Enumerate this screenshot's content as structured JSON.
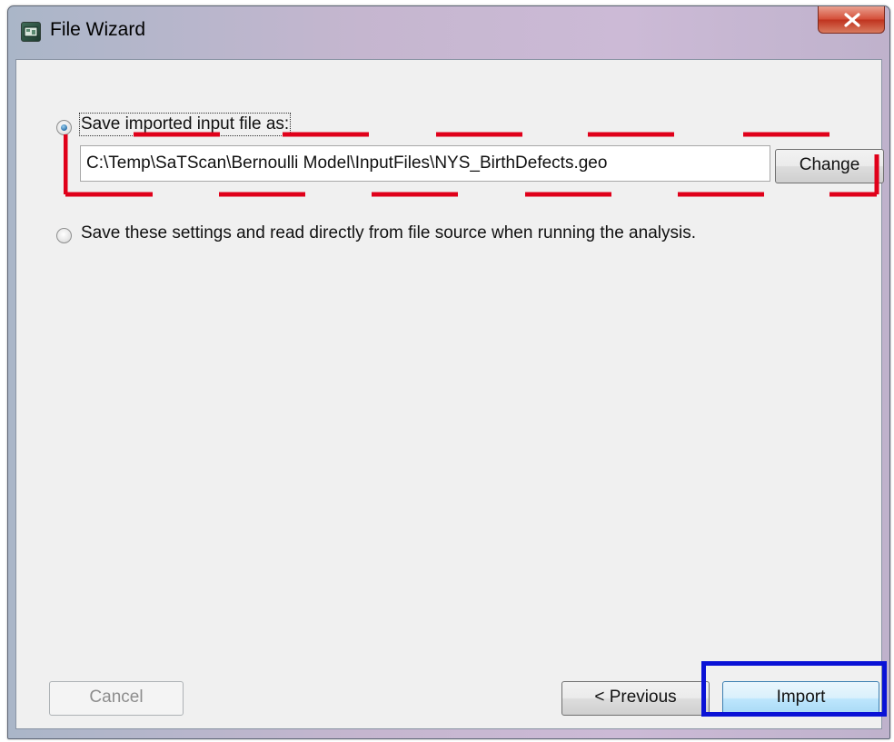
{
  "window": {
    "title": "File Wizard",
    "app_icon": "satscan-app-icon",
    "close_icon": "close-icon"
  },
  "options": {
    "save_imported": {
      "label": "Save imported input file as:",
      "selected": true
    },
    "file_path": "C:\\Temp\\SaTScan\\Bernoulli Model\\InputFiles\\NYS_BirthDefects.geo",
    "change_label": "Change",
    "read_directly": {
      "label": "Save these settings and read directly from file source when running the analysis.",
      "selected": false
    }
  },
  "footer": {
    "cancel_label": "Cancel",
    "previous_label": "< Previous",
    "import_label": "Import"
  },
  "annotations": {
    "dashed_box_color": "#e0001a",
    "highlight_box_color": "#0a12d6"
  }
}
